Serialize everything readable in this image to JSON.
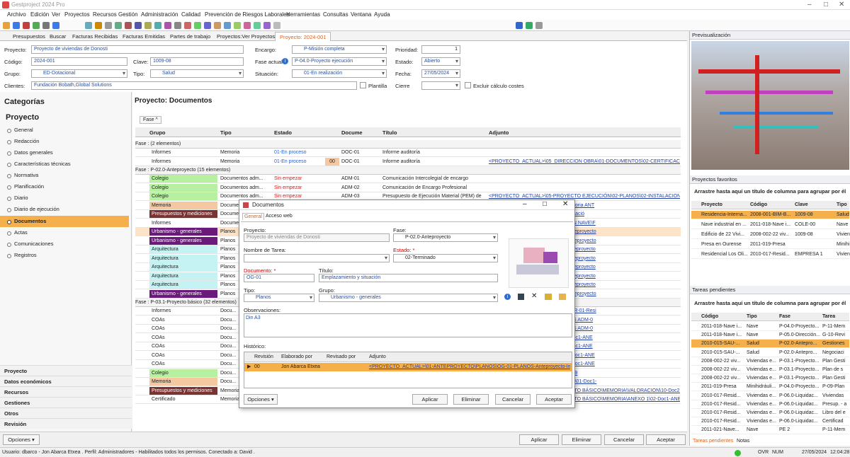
{
  "app": {
    "title": "Gestproject 2024 Pro"
  },
  "menu": [
    "Archivo",
    "Edición",
    "Ver",
    "Proyectos",
    "Recursos",
    "Gestión",
    "Administración",
    "Calidad",
    "Prevención de Riesgos Laborales",
    "Herramientas",
    "Consultas",
    "Ventana",
    "Ayuda"
  ],
  "tabs": [
    "Presupuestos",
    "Buscar",
    "Facturas Recibidas",
    "Facturas Emitidas",
    "Partes de trabajo",
    "Proyectos:Ver Proyectos",
    "Proyecto: 2024-001"
  ],
  "form": {
    "proyecto_label": "Proyecto:",
    "proyecto": "Proyecto de viviendas de Donosti",
    "codigo_label": "Código:",
    "codigo": "2024-001",
    "clave_label": "Clave:",
    "clave": "1009-08",
    "grupo_label": "Grupo:",
    "grupo": "ED-Dotacional",
    "tipo_label": "Tipo:",
    "tipo": "Salud",
    "clientes_label": "Clientes:",
    "clientes": "Fundación Bobath,Global Solutions",
    "plantilla": "Plantilla",
    "encargo_label": "Encargo:",
    "encargo": "P-Misión completa",
    "fase_label": "Fase actual:",
    "fase": "P-04.0-Proyecto ejecución",
    "situacion_label": "Situación:",
    "situacion": "01-En realización",
    "prioridad_label": "Prioridad:",
    "prioridad": "1",
    "estado_label": "Estado:",
    "estado": "Abierto",
    "fecha_label": "Fecha:",
    "fecha": "27/05/2024",
    "cierre_label": "Cierre",
    "excluir": "Excluir cálculo costes"
  },
  "sidebar": {
    "title": "Categorías",
    "section": "Proyecto",
    "items": [
      "General",
      "Redacción",
      "Datos generales",
      "Características técnicas",
      "Normativa",
      "Planificación",
      "Diario",
      "Diario de ejecución",
      "Documentos",
      "Actas",
      "Comunicaciones",
      "Registros"
    ],
    "bottom": [
      "Proyecto",
      "Datos económicos",
      "Recursos",
      "Gestiones",
      "Otros",
      "Revisión"
    ]
  },
  "main": {
    "title": "Proyecto: Documentos",
    "group_chip": "Fase",
    "headers": [
      "Grupo",
      "Tipo",
      "Estado",
      "Docume",
      "Título",
      "Adjunto"
    ],
    "groups": [
      "Fase : (2 elementos)",
      "Fase : P-02.0-Anteproyecto (15 elementos)",
      "Fase : P-03.1-Proyecto básico (32 elementos)"
    ],
    "rows1": [
      [
        "Informes",
        "Memoria",
        "01-En proceso",
        "",
        "DOC-01",
        "Informe auditoría",
        ""
      ],
      [
        "Informes",
        "Memoria",
        "01-En proceso",
        "00",
        "DOC-01",
        "Informe auditoría",
        "<PROYECTO_ACTUAL>\\05_DIRECCION OBRA\\01-DOCUMENTOS\\02-CERTIFICACIONES"
      ]
    ],
    "rows2": [
      [
        "Colegio",
        "Documentos adm...",
        "Sin empezar",
        "",
        "ADM-01",
        "Comunicación Intercolegial de encargo",
        ""
      ],
      [
        "Colegio",
        "Documentos adm...",
        "Sin empezar",
        "",
        "ADM-02",
        "Comunicación de Encargo Profesional",
        ""
      ],
      [
        "Colegio",
        "Documentos adm...",
        "Sin empezar",
        "",
        "ADM-03",
        "Presupuesto de Ejecución Material (PEM) de",
        "<PROYECTO_ACTUAL>\\05-PROYECTO EJECUCIÓN\\02-PLANOS\\02-INSTALACIONES\\PL"
      ],
      [
        "Memoria",
        "Documentos adm...",
        "",
        "",
        "",
        "",
        "YECTO\\DOCUMENTOS\\DOC-01-Memoria ANT"
      ],
      [
        "Presupuestos y mediciones",
        "Documentos adm...",
        "",
        "",
        "",
        "",
        "YECTO\\DOCUMENTOS\\DOC-01-Valoració"
      ],
      [
        "Informes",
        "Documentos adm...",
        "",
        "",
        "",
        "",
        "ndustrial en Andoain\\01-CIMENTACION NAVE\\F"
      ],
      [
        "Urbanismo - generales",
        "Planos",
        "",
        "",
        "",
        "",
        "YECTO\\PLANOS\\OG-01-PLANOS-Anteproyecto"
      ],
      [
        "Urbanismo - generales",
        "Planos",
        "",
        "",
        "",
        "",
        "YECTO\\PLANOS\\OG-03-PLANOS-Anteproyecto"
      ],
      [
        "Arquitectura",
        "Planos",
        "",
        "",
        "",
        "",
        "YECTO\\PLANOS\\AQ-01-PLANOS-Anteproyecto"
      ],
      [
        "Arquitectura",
        "Planos",
        "",
        "",
        "",
        "",
        "YECTO\\PLANOS\\AQ-02-PLANOS-Anteproyecto"
      ],
      [
        "Arquitectura",
        "Planos",
        "",
        "",
        "",
        "",
        "YECTO\\PLANOS\\AQ-03-PLANOS-Anteproyecto"
      ],
      [
        "Arquitectura",
        "Planos",
        "",
        "",
        "",
        "",
        "YECTO\\PLANOS\\AQ-04-PLANOS-Anteproyecto"
      ],
      [
        "Arquitectura",
        "Planos",
        "",
        "",
        "",
        "",
        "YECTO\\PLANOS\\AQ-05-PLANOS-Anteproyecto"
      ],
      [
        "Urbanismo - generales",
        "Planos",
        "",
        "",
        "",
        "",
        "YECTO\\PLANOS\\OG-02-PLANOS-Anteproyecto"
      ]
    ],
    "rows3": [
      [
        "Informes",
        "Docu...",
        "",
        "",
        "",
        "",
        "O BÁSICO\\PLANOS\\RESIDUOS\\18-GR-01-Resi"
      ],
      [
        "COAs",
        "Docu...",
        "",
        "",
        "",
        "",
        "O BÁSICO\\MEMORIA\\ANEXO 2\\DOCS ADM-0"
      ],
      [
        "COAs",
        "Docu...",
        "",
        "",
        "",
        "",
        "O BÁSICO\\MEMORIA\\ANEXO 2\\DOCS ADM-0"
      ],
      [
        "COAs",
        "Docu...",
        "",
        "",
        "",
        "",
        "O BÁSICO\\MEMORIA\\ANEXO 2\\03-Doc1-ANE"
      ],
      [
        "COAs",
        "Docu...",
        "",
        "",
        "",
        "",
        "O BÁSICO\\MEMORIA\\ANEXO 1\\01-Doc1-ANE"
      ],
      [
        "COAs",
        "Docu...",
        "",
        "",
        "",
        "",
        "O BÁSICO\\MEMORIA\\MEMORIA\\05-Doc1-ANE"
      ],
      [
        "COAs",
        "Docu...",
        "",
        "",
        "",
        "",
        "O BÁSICO\\MEMORIA\\MEMORIA\\06-Doc1-ANE"
      ],
      [
        "Colegio",
        "Docu...",
        "",
        "",
        "",
        "",
        "COAM\\00-BASICO\\02-VISADO_020609"
      ],
      [
        "Memoria",
        "Docu...",
        "",
        "",
        "",
        "",
        "O BÁSICO\\DOCUMENTOS\\MEMORIA\\01-Doc1-"
      ],
      [
        "Presupuestos y mediciones",
        "Memoria",
        "02-Terminado",
        "02",
        "DOC-02",
        "Presupuesto",
        "<PROYECTO_ACTUAL>\\04-PROYECTO BÁSICO\\MEMORIA\\VALORACION\\10-Doc2-"
      ],
      [
        "Certificado",
        "Memoria",
        "02-Terminado",
        "02",
        "DOC-01.1",
        "Anexo 1. Certificado de viabilidad",
        "<PROYECTO_ACTUAL>\\04-PROYECTO BÁSICO\\MEMORIA\\ANEXO 1\\02-Doc1-ANE"
      ]
    ]
  },
  "dialog": {
    "title": "Documentos",
    "tab1": "General",
    "tab2": "Acceso web",
    "proyecto_label": "Proyecto:",
    "proyecto": "Proyecto de viviendas de Donosti",
    "fase_label": "Fase:",
    "fase": "P-02.0-Anteproyecto",
    "tarea_label": "Nombre de Tarea:",
    "estado_label": "Estado: *",
    "estado": "02-Terminado",
    "documento_label": "Documento: *",
    "documento": "OG-01",
    "titulo_label": "Título:",
    "titulo": "Emplazamiento y situación",
    "tipo_label": "Tipo:",
    "tipo": "Planos",
    "grupo_label": "Grupo:",
    "grupo": "Urbanismo - generales",
    "obs_label": "Observaciones:",
    "obs": "Din A3",
    "historico_label": "Histórico:",
    "hist_headers": [
      "Revisión",
      "Elaborado por",
      "Revisado por",
      "Adjunto"
    ],
    "hist_row": [
      "00",
      "Jon Abarca Etxea",
      "",
      "<PROYECTO_ACTUAL>\\01-ANTEPROYECTO\\PLANOS\\OG-01-PLANOS-Anteproyecto-Internado"
    ],
    "opciones": "Opciones",
    "aplicar": "Aplicar",
    "eliminar": "Eliminar",
    "cancelar": "Cancelar",
    "aceptar": "Aceptar"
  },
  "right": {
    "preview_title": "Previsualización",
    "fav_title": "Proyectos favoritos",
    "fav_hint": "Arrastre hasta aquí un título de columna para agrupar por él",
    "fav_headers": [
      "Proyecto",
      "Código",
      "Clave",
      "Tipo"
    ],
    "fav_rows": [
      [
        "Residencia-Interna...",
        "2008-001-BIM-B...",
        "1009-08",
        "Salud"
      ],
      [
        "Nave industrial en ...",
        "2011-018-Nave i...",
        "COLE-00",
        "Nave"
      ],
      [
        "Edificio de 22 Vivi...",
        "2008-002-22 viv...",
        "1009-08",
        "Vivien"
      ],
      [
        "Presa en Ourense",
        "2011-019-Presa",
        "",
        "Minihi"
      ],
      [
        "Residencial Los Oli...",
        "2010-017-Resid...",
        "EMPRESA 1",
        "Vivien"
      ]
    ],
    "tasks_title": "Tareas pendientes",
    "tasks_hint": "Arrastre hasta aquí un título de columna para agrupar por él",
    "task_headers": [
      "Código",
      "Tipo",
      "Fase",
      "Tarea"
    ],
    "task_rows": [
      [
        "2011-018-Nave i...",
        "Nave",
        "P-04.0-Proyecto...",
        "P-11-Mem"
      ],
      [
        "2011-018-Nave i...",
        "Nave",
        "P-05.0-Dirección...",
        "G-10-Revi"
      ],
      [
        "2010-015-SAU-...",
        "Salud",
        "P-02.0-Antepro...",
        "Gestiones"
      ],
      [
        "2010-015-SAU-...",
        "Salud",
        "P-02.0-Antepro...",
        "Negociaci"
      ],
      [
        "2008-002-22 viv...",
        "Viviendas e...",
        "P-03.1-Proyecto...",
        "Plan Gesti"
      ],
      [
        "2008-002-22 viv...",
        "Viviendas e...",
        "P-03.1-Proyecto...",
        "Plan de s"
      ],
      [
        "2008-002-22 viv...",
        "Viviendas e...",
        "P-03.1-Proyecto...",
        "Plan Gesti"
      ],
      [
        "2011-019-Presa",
        "Minihidráuli...",
        "P-04.0-Proyecto...",
        "P-09-Plan"
      ],
      [
        "2010-017-Resid...",
        "Viviendas e...",
        "P-06.0-Liquidac...",
        "Viviendas"
      ],
      [
        "2010-017-Resid...",
        "Viviendas e...",
        "P-06.0-Liquidac...",
        "Presup. - a"
      ],
      [
        "2010-017-Resid...",
        "Viviendas e...",
        "P-06.0-Liquidac...",
        "Libro del e"
      ],
      [
        "2010-017-Resid...",
        "Viviendas e...",
        "P-06.0-Liquidac...",
        "Certificad"
      ],
      [
        "2011-021-Nave...",
        "Nave",
        "PE 2",
        "P-11-Mem"
      ]
    ],
    "tab_tareas": "Tareas pendientes",
    "tab_notas": "Notas"
  },
  "bottom": {
    "opciones": "Opciones",
    "aplicar": "Aplicar",
    "eliminar": "Eliminar",
    "cancelar": "Cancelar",
    "aceptar": "Aceptar"
  },
  "status": {
    "user": "Usuario: dbarco - Jon Abarca Etxea . Perfil: Administradores - Habilitados todos los permisos.  Conectado a: David .",
    "ovr": "OVR",
    "num": "NUM",
    "date": "27/05/2024",
    "time": "12:04:28"
  },
  "colors": {
    "accent": "#e0621b",
    "selected": "#f6b04b",
    "green": "#b6f0a0",
    "cyan": "#c5f3f3",
    "brown": "#7a3333",
    "purple": "#6a1a7a",
    "salmon": "#f4c8a0"
  }
}
